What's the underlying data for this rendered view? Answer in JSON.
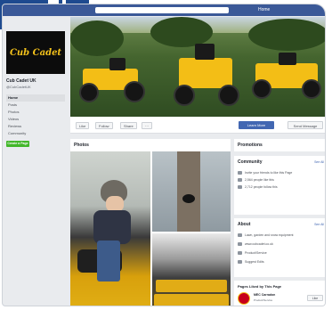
{
  "topbar": {
    "nav_items": [
      "Home"
    ]
  },
  "sidebar": {
    "logo_text": "Cub Cadet",
    "page_name": "Cub Cadet UK",
    "page_handle": "@CubCadetUK",
    "items": [
      {
        "label": "Home"
      },
      {
        "label": "Posts"
      },
      {
        "label": "Photos"
      },
      {
        "label": "Videos"
      },
      {
        "label": "Reviews"
      },
      {
        "label": "Community"
      }
    ],
    "create_page_label": "Create a Page"
  },
  "actions": {
    "like": "Like",
    "follow": "Follow",
    "share": "Share",
    "more": "···",
    "learn_more": "Learn More",
    "send_message": "Send Message"
  },
  "photos": {
    "title": "Photos"
  },
  "right": {
    "promote": {
      "title": "Promotions"
    },
    "community": {
      "title": "Community",
      "see_all": "See All",
      "rows": [
        "Invite your friends to like this Page",
        "2,564 people like this",
        "2,712 people follow this"
      ]
    },
    "about": {
      "title": "About",
      "see_all": "See All",
      "rows": [
        "Lawn, garden and snow equipment",
        "www.cubcadet.co.uk",
        "Product/Service",
        "Suggest Edits"
      ]
    },
    "related": {
      "title": "Pages Liked by This Page",
      "name": "MEC Carradon",
      "sub": "Product/Service",
      "like": "Like"
    }
  },
  "colors": {
    "facebook_blue": "#3b5998",
    "cub_cadet_yellow": "#f3be16",
    "button_blue": "#4267b2",
    "create_green": "#42b72a"
  }
}
